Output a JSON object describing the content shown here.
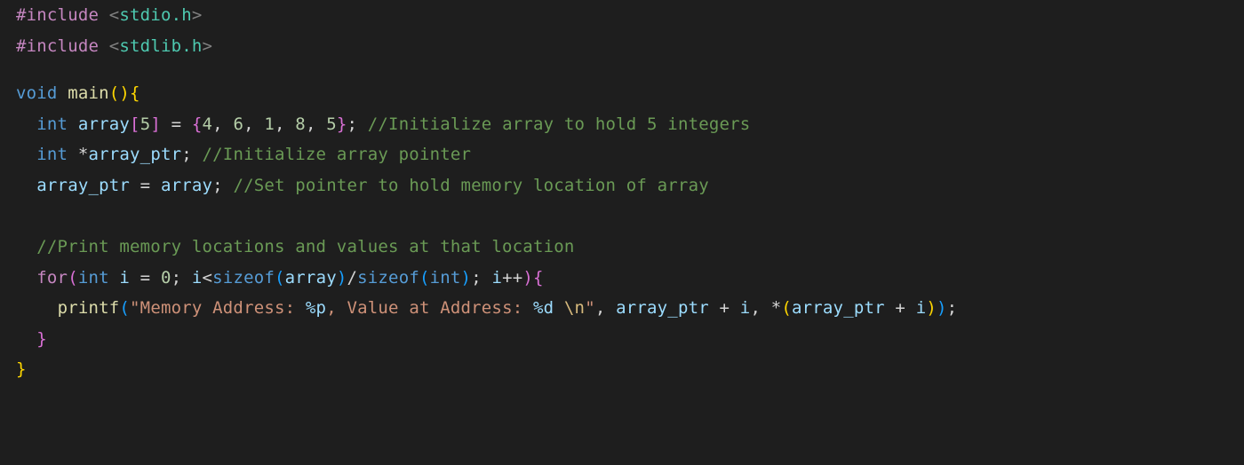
{
  "code": {
    "l1": {
      "include": "#include",
      "lt": "<",
      "file": "stdio.h",
      "gt": ">"
    },
    "l2": {
      "include": "#include",
      "lt": "<",
      "file": "stdlib.h",
      "gt": ">"
    },
    "l3": "",
    "l4": {
      "void": "void",
      "main": "main",
      "lp": "(",
      "rp": ")",
      "lb": "{"
    },
    "l5": {
      "indent": "  ",
      "int": "int",
      "sp1": " ",
      "arr": "array",
      "lbr": "[",
      "size": "5",
      "rbr": "]",
      "eq": " = ",
      "lb": "{",
      "v1": "4",
      "c1": ", ",
      "v2": "6",
      "c2": ", ",
      "v3": "1",
      "c3": ", ",
      "v4": "8",
      "c4": ", ",
      "v5": "5",
      "rb": "}",
      "semi": ";",
      "sp2": " ",
      "cm": "//Initialize array to hold 5 integers"
    },
    "l6": {
      "indent": "  ",
      "int": "int",
      "sp1": " ",
      "star": "*",
      "ptr": "array_ptr",
      "semi": ";",
      "sp2": " ",
      "cm": "//Initialize array pointer"
    },
    "l7": {
      "indent": "  ",
      "ptr": "array_ptr",
      "eq": " = ",
      "arr": "array",
      "semi": ";",
      "sp2": " ",
      "cm": "//Set pointer to hold memory location of array"
    },
    "l8": "  ",
    "l9": {
      "indent": "  ",
      "cm": "//Print memory locations and values at that location"
    },
    "l10": {
      "indent": "  ",
      "for": "for",
      "lp": "(",
      "int": "int",
      "sp1": " ",
      "i": "i",
      "eq": " = ",
      "zero": "0",
      "semi1": ";",
      "cond1": " ",
      "i2": "i",
      "lt": "<",
      "sizeof1": "sizeof",
      "lp2": "(",
      "arr": "array",
      "rp2": ")",
      "slash": "/",
      "sizeof2": "sizeof",
      "lp3": "(",
      "intty": "int",
      "rp3": ")",
      "semi2": ";",
      "sp2": " ",
      "i3": "i",
      "pp": "++",
      "rp": ")",
      "lb": "{"
    },
    "l11": {
      "indent": "    ",
      "printf": "printf",
      "lp": "(",
      "q1": "\"Memory Address: ",
      "fmt1": "%p",
      "mid": ", Value at Address: ",
      "fmt2": "%d",
      "sp": " ",
      "esc": "\\n",
      "q2": "\"",
      "c1": ", ",
      "ptr1": "array_ptr",
      "plus1": " + ",
      "i1": "i",
      "c2": ", *",
      "lp2": "(",
      "ptr2": "array_ptr",
      "plus2": " + ",
      "i2": "i",
      "rp2": ")",
      "rp": ")",
      "semi": ";"
    },
    "l12": {
      "indent": "  ",
      "rb": "}"
    },
    "l13": {
      "rb": "}"
    }
  }
}
